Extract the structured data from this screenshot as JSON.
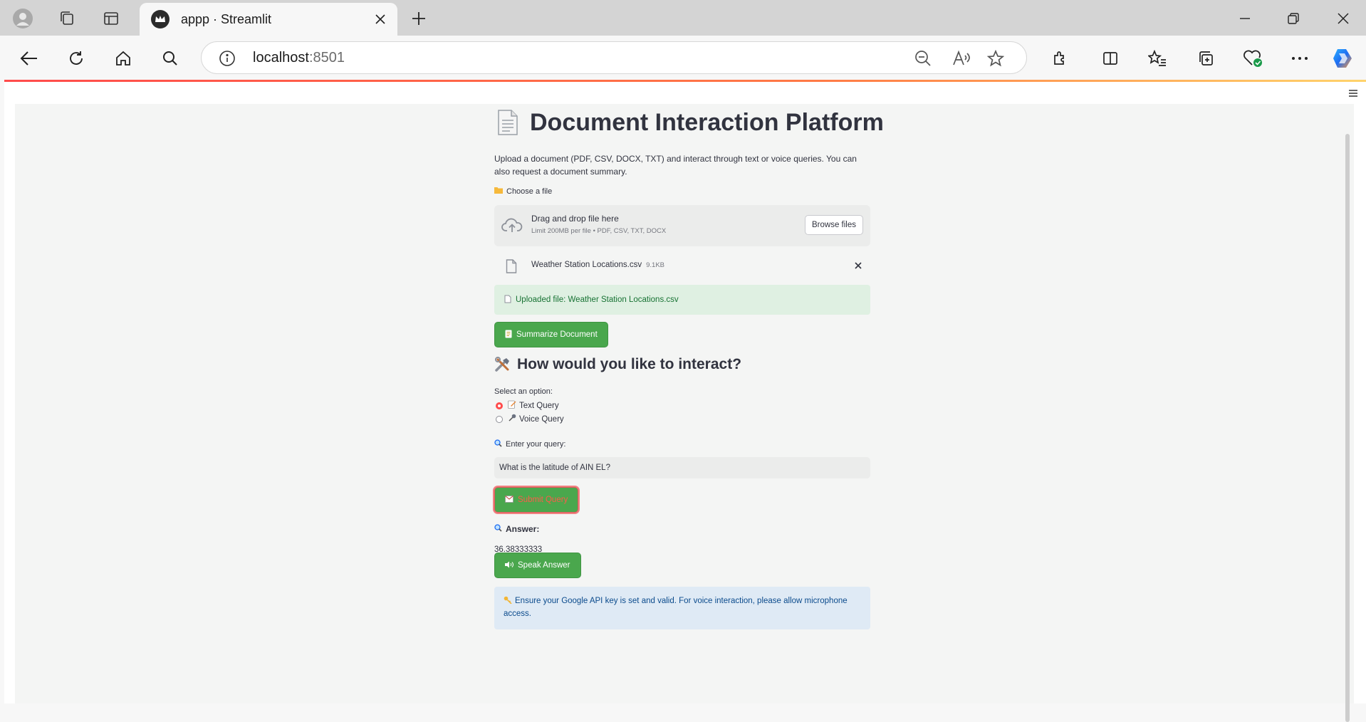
{
  "browser": {
    "tab_title": "appp · Streamlit",
    "url_host": "localhost",
    "url_port": ":8501"
  },
  "app": {
    "title": "Document Interaction Platform",
    "title_icon": "page-facing-up-emoji",
    "description": "Upload a document (PDF, CSV, DOCX, TXT) and interact through text or voice queries. You can also request a document summary.",
    "uploader": {
      "label": "Choose a file",
      "drag_text": "Drag and drop file here",
      "limit_text": "Limit 200MB per file • PDF, CSV, TXT, DOCX",
      "browse_label": "Browse files",
      "file_name": "Weather Station Locations.csv",
      "file_size": "9.1KB"
    },
    "success_message": "Uploaded file: Weather Station Locations.csv",
    "summarize_label": "Summarize Document",
    "interact_heading": "How would you like to interact?",
    "select_label": "Select an option:",
    "options": [
      {
        "label": "Text Query",
        "selected": true
      },
      {
        "label": "Voice Query",
        "selected": false
      }
    ],
    "query_label": "Enter your query:",
    "query_value": "What is the latitude of AIN EL?",
    "submit_label": "Submit Query",
    "answer_heading": "Answer:",
    "answer_value": "36.38333333",
    "speak_label": "Speak Answer",
    "info_message": "Ensure your Google API key is set and valid. For voice interaction, please allow microphone access."
  },
  "colors": {
    "primary_button": "#4aa74d",
    "success_bg": "#dff0e2",
    "info_bg": "#dfeaf5",
    "radio_accent": "#ff4b4b"
  }
}
